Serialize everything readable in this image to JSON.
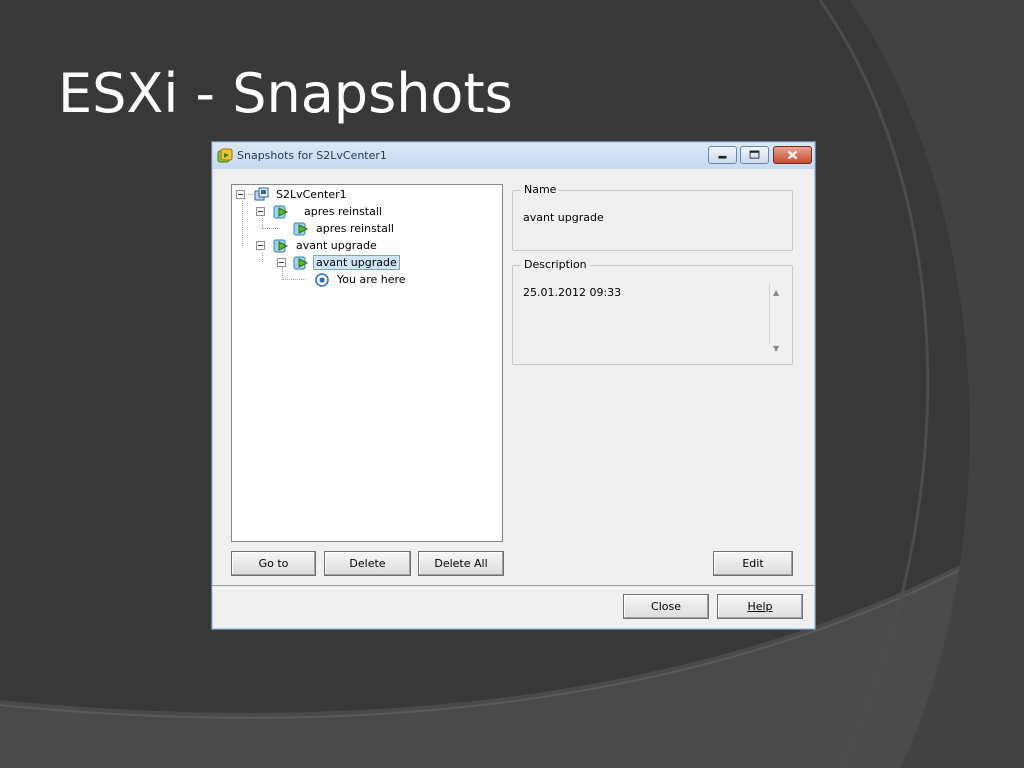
{
  "slide": {
    "title": "ESXi - Snapshots"
  },
  "window": {
    "title": "Snapshots for S2LvCenter1",
    "icon": "snapshot-manager-icon"
  },
  "tree": {
    "root": "S2LvCenter1",
    "items": [
      {
        "label": "apres reinstall"
      },
      {
        "label": "apres reinstall"
      },
      {
        "label": "avant upgrade"
      },
      {
        "label": "avant upgrade"
      },
      {
        "label": "You are here"
      }
    ]
  },
  "buttons": {
    "goto": "Go to",
    "delete": "Delete",
    "delete_all": "Delete All",
    "edit": "Edit",
    "close": "Close",
    "help": "Help"
  },
  "details": {
    "name_label": "Name",
    "name_value": "avant upgrade",
    "description_label": "Description",
    "description_value": "25.01.2012 09:33"
  },
  "colors": {
    "slide_background": "#3a3a3a",
    "selection": "#cde4fb",
    "close_button": "#c74a2d"
  }
}
